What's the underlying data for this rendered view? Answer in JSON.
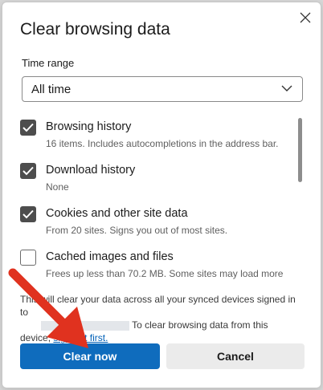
{
  "dialog": {
    "title": "Clear browsing data",
    "close_icon": "close-icon"
  },
  "time_range": {
    "label": "Time range",
    "selected": "All time"
  },
  "items": [
    {
      "title": "Browsing history",
      "desc": "16 items. Includes autocompletions in the address bar.",
      "checked": true
    },
    {
      "title": "Download history",
      "desc": "None",
      "checked": true
    },
    {
      "title": "Cookies and other site data",
      "desc": "From 20 sites. Signs you out of most sites.",
      "checked": true
    },
    {
      "title": "Cached images and files",
      "desc": "Frees up less than 70.2 MB. Some sites may load more",
      "checked": false
    }
  ],
  "info": {
    "line1": "This will clear your data across all your synced devices signed in to",
    "line2_suffix": "To clear browsing data from this",
    "line3_prefix": "device,",
    "link": "sign out first."
  },
  "buttons": {
    "primary": "Clear now",
    "secondary": "Cancel"
  },
  "colors": {
    "accent": "#0f6cbd",
    "arrow": "#e0321f"
  }
}
